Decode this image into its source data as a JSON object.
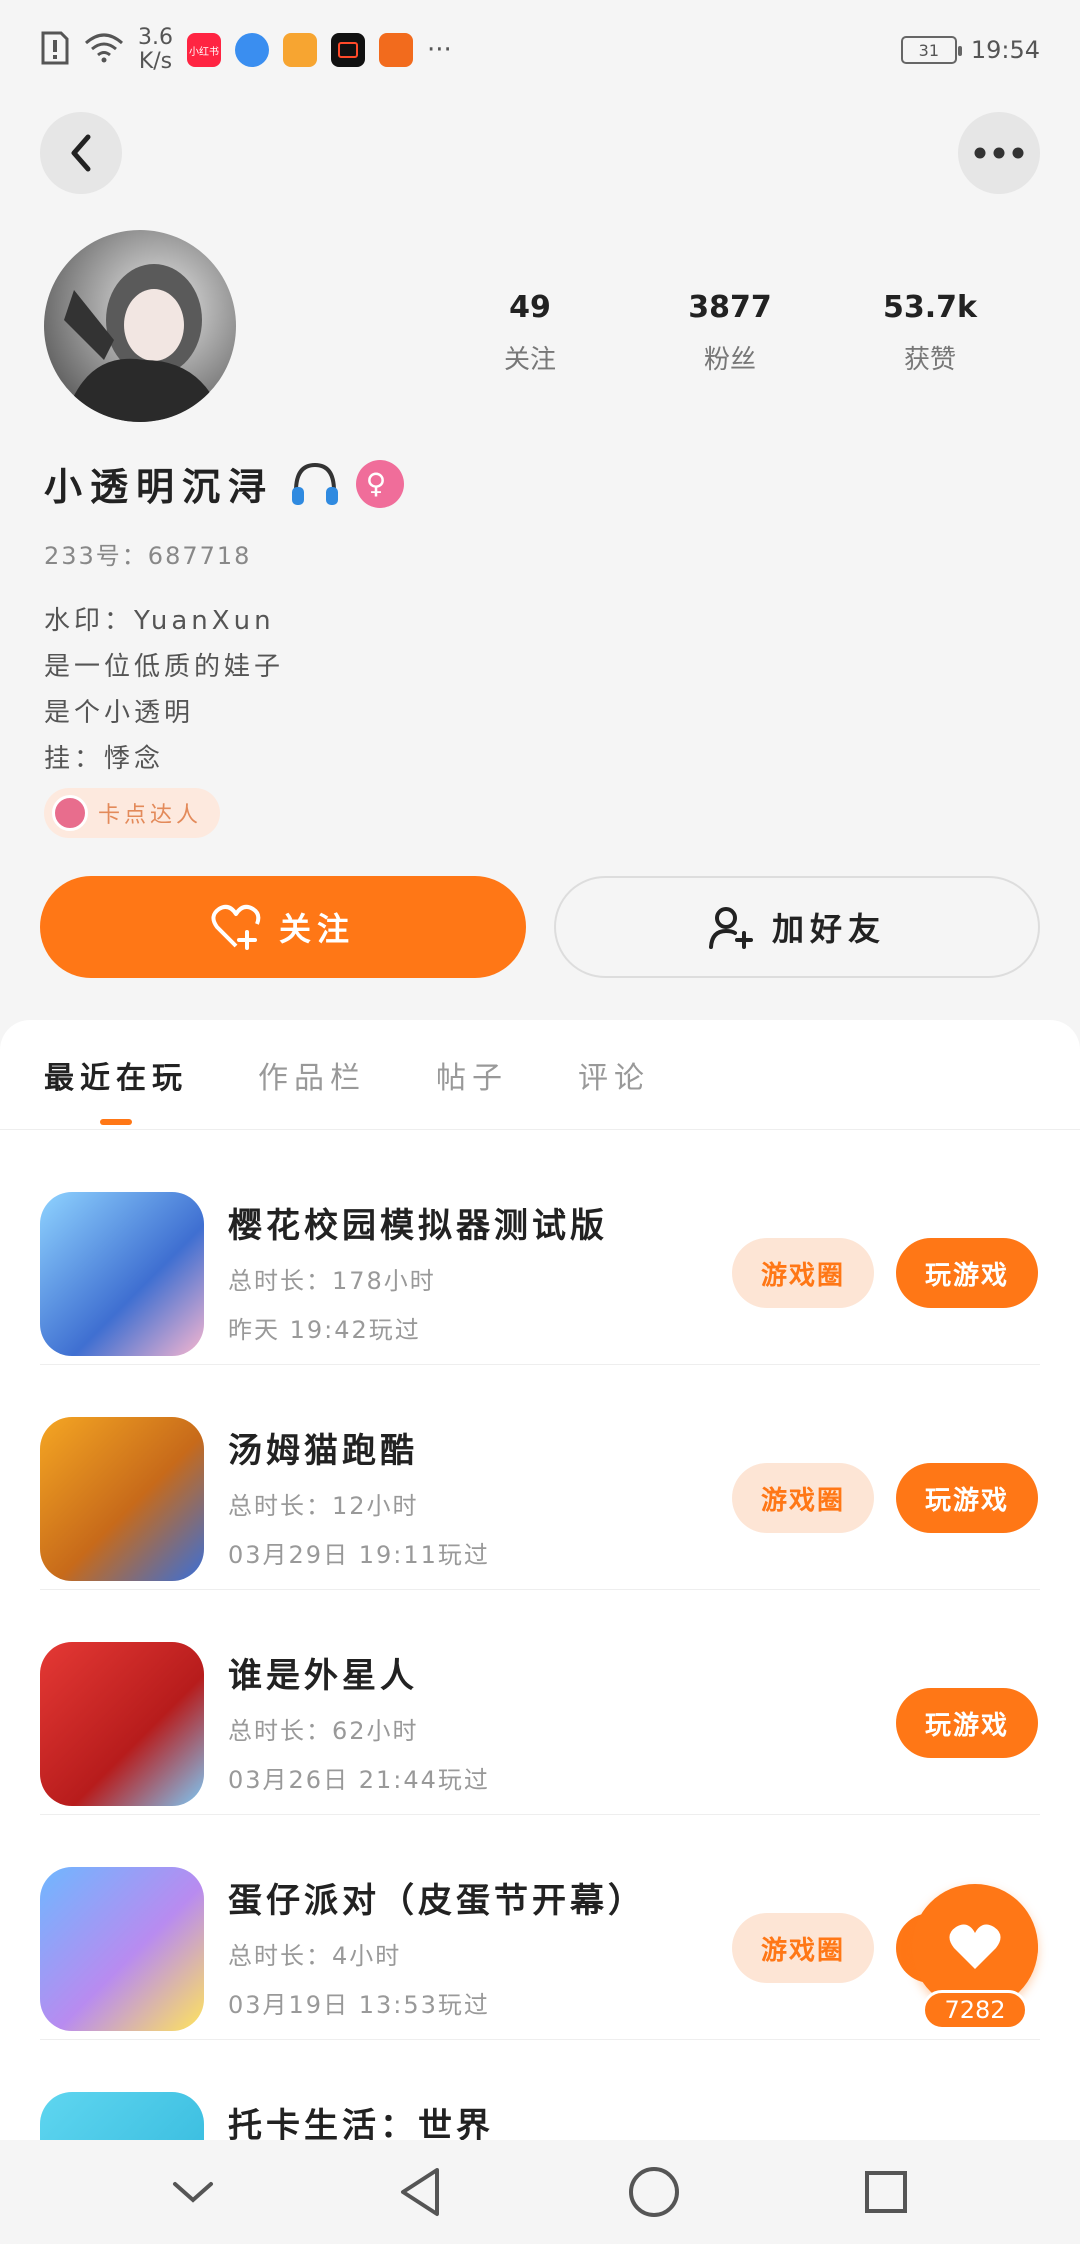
{
  "status_bar": {
    "speed_value": "3.6",
    "speed_unit": "K/s",
    "app_icons": [
      "notification-icon",
      "wifi-icon",
      "xiaohongshu-icon",
      "browser-icon",
      "app-icon",
      "video-icon",
      "app-icon-2"
    ],
    "app1_label": "小红书",
    "more": "···",
    "battery": "31",
    "time": "19:54"
  },
  "profile": {
    "username": "小透明沉浔",
    "gender_symbol": "♀",
    "uid": "233号：687718",
    "bio": [
      "水印：YuanXun",
      "是一位低质的娃子",
      "是个小透明",
      "挂：悸念"
    ],
    "badge": "卡点达人",
    "stats": [
      {
        "value": "49",
        "label": "关注"
      },
      {
        "value": "3877",
        "label": "粉丝"
      },
      {
        "value": "53.7k",
        "label": "获赞"
      }
    ],
    "follow_label": "关注",
    "add_friend_label": "加好友"
  },
  "tabs": [
    "最近在玩",
    "作品栏",
    "帖子",
    "评论"
  ],
  "games": [
    {
      "title": "樱花校园模拟器测试版",
      "duration": "总时长：178小时",
      "last_played": "昨天 19:42玩过",
      "circle_label": "游戏圈",
      "play_label": "玩游戏",
      "has_circle": true
    },
    {
      "title": "汤姆猫跑酷",
      "duration": "总时长：12小时",
      "last_played": "03月29日 19:11玩过",
      "circle_label": "游戏圈",
      "play_label": "玩游戏",
      "has_circle": true
    },
    {
      "title": "谁是外星人",
      "duration": "总时长：62小时",
      "last_played": "03月26日 21:44玩过",
      "circle_label": "",
      "play_label": "玩游戏",
      "has_circle": false
    },
    {
      "title": "蛋仔派对（皮蛋节开幕）",
      "duration": "总时长：4小时",
      "last_played": "03月19日 13:53玩过",
      "circle_label": "游戏圈",
      "play_label": "玩游戏",
      "has_circle": true
    },
    {
      "title": "托卡生活：世界",
      "duration": "",
      "last_played": "",
      "circle_label": "",
      "play_label": "",
      "has_circle": false
    }
  ],
  "like_count": "7282",
  "colors": {
    "accent": "#ff7716",
    "accent_light": "#fde5d5",
    "gender": "#f06d9a"
  }
}
